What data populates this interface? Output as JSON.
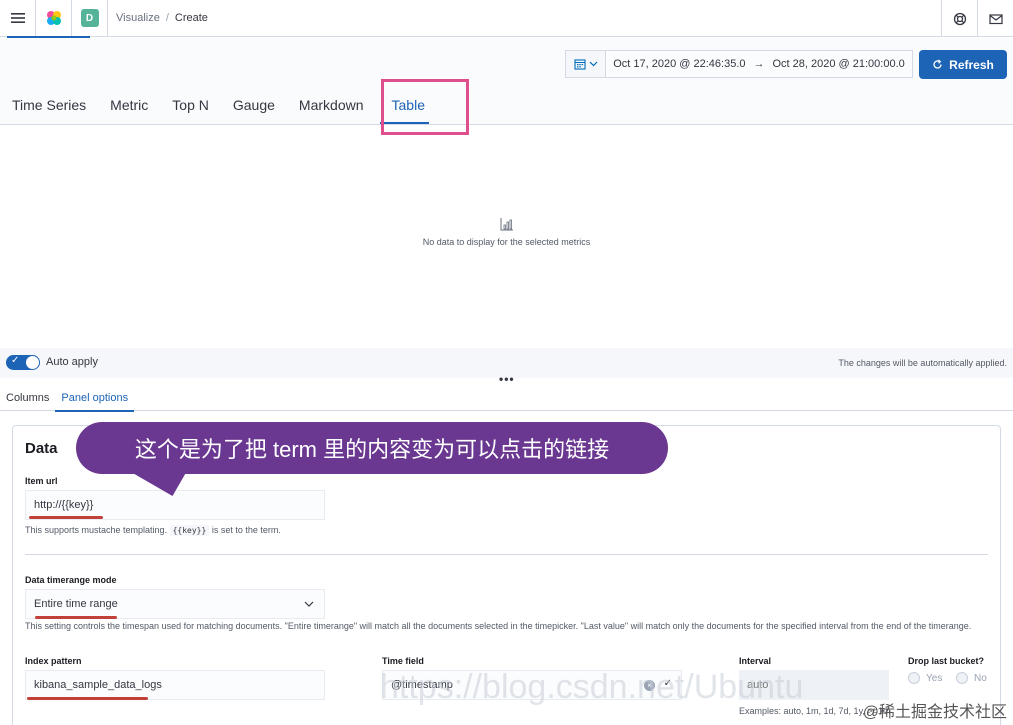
{
  "topbar": {
    "space_initial": "D",
    "breadcrumb_parent": "Visualize",
    "breadcrumb_sep": "/",
    "breadcrumb_current": "Create"
  },
  "datepicker": {
    "start": "Oct 17, 2020 @ 22:46:35.0",
    "arrow": "→",
    "end": "Oct 28, 2020 @ 21:00:00.0"
  },
  "refresh_label": "Refresh",
  "tabs": [
    {
      "label": "Time Series"
    },
    {
      "label": "Metric"
    },
    {
      "label": "Top N"
    },
    {
      "label": "Gauge"
    },
    {
      "label": "Markdown"
    },
    {
      "label": "Table",
      "active": true
    }
  ],
  "empty_state": "No data to display for the selected metrics",
  "auto_apply": {
    "label": "Auto apply",
    "note": "The changes will be automatically applied."
  },
  "subtabs": [
    {
      "label": "Columns"
    },
    {
      "label": "Panel options",
      "active": true
    }
  ],
  "panel": {
    "title": "Data",
    "item_url": {
      "label": "Item url",
      "value": "http://{{key}}",
      "help_before": "This supports mustache templating.",
      "help_code": "{{key}}",
      "help_after": "is set to the term."
    },
    "timerange_mode": {
      "label": "Data timerange mode",
      "value": "Entire time range",
      "help": "This setting controls the timespan used for matching documents. \"Entire timerange\" will match all the documents selected in the timepicker. \"Last value\" will match only the documents for the specified interval from the end of the timerange."
    },
    "index_pattern": {
      "label": "Index pattern",
      "value": "kibana_sample_data_logs"
    },
    "time_field": {
      "label": "Time field",
      "value": "@timestamp"
    },
    "interval": {
      "label": "Interval",
      "placeholder": "auto",
      "help": "Examples: auto, 1m, 1d, 7d, 1y, >=1m"
    },
    "drop_last_bucket": {
      "label": "Drop last bucket?",
      "yes": "Yes",
      "no": "No"
    }
  },
  "callout_text": "这个是为了把 term 里的内容变为可以点击的链接",
  "watermark": "https://blog.csdn.net/Ubuntu",
  "corner_mark": "@稀土掘金技术社区"
}
